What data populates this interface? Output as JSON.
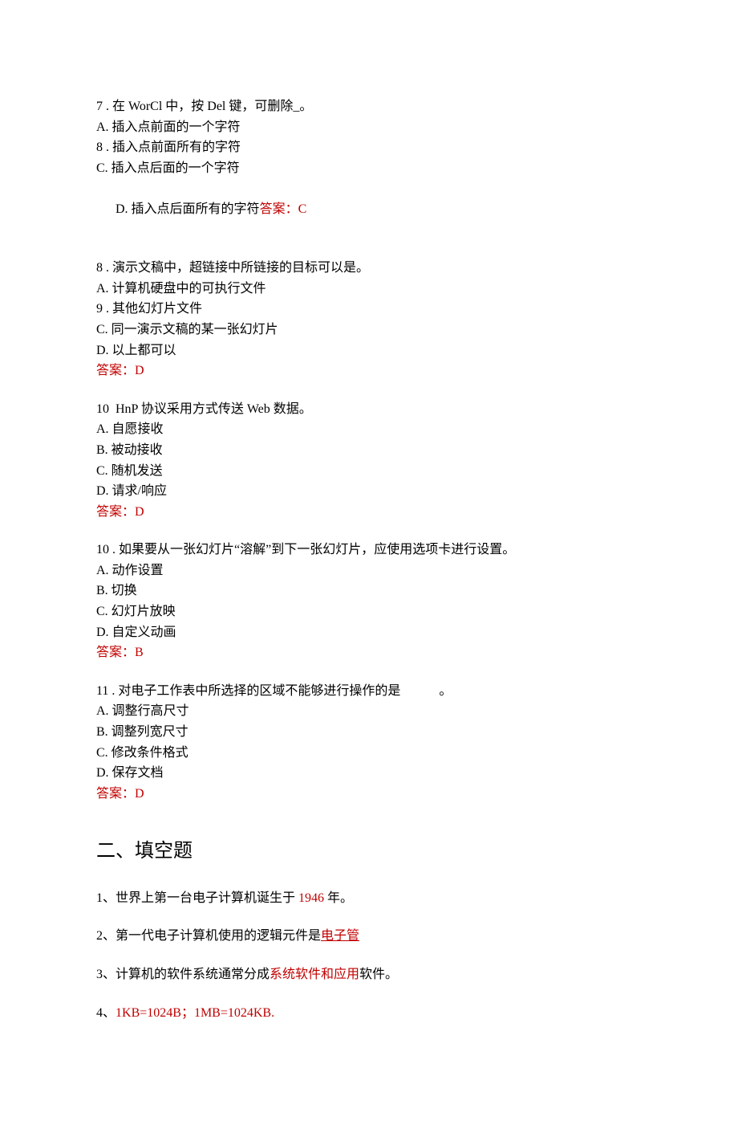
{
  "q7": {
    "stem": "7 . 在 WorCl 中，按 Del 键，可删除_。",
    "optA": "A. 插入点前面的一个字符",
    "optB": "8 . 插入点前面所有的字符",
    "optC": "C. 插入点后面的一个字符",
    "optD_prefix": "D. 插入点后面所有的字符",
    "optD_answer": "答案：C"
  },
  "q8": {
    "stem": "8 . 演示文稿中，超链接中所链接的目标可以是。",
    "optA": "A. 计算机硬盘中的可执行文件",
    "optB": "9 . 其他幻灯片文件",
    "optC": "C. 同一演示文稿的某一张幻灯片",
    "optD": "D. 以上都可以",
    "answer": "答案：D"
  },
  "q10a": {
    "stem": "10  HnP 协议采用方式传送 Web 数据。",
    "optA": "A. 自愿接收",
    "optB": "B. 被动接收",
    "optC": "C. 随机发送",
    "optD": "D. 请求/响应",
    "answer": "答案：D"
  },
  "q10b": {
    "stem": "10 . 如果要从一张幻灯片“溶解”到下一张幻灯片，应使用选项卡进行设置。",
    "optA": "A. 动作设置",
    "optB": "B. 切换",
    "optC": "C. 幻灯片放映",
    "optD": "D. 自定义动画",
    "answer": "答案：B"
  },
  "q11": {
    "stem": "11 . 对电子工作表中所选择的区域不能够进行操作的是　　　。",
    "optA": "A. 调整行高尺寸",
    "optB": "B. 调整列宽尺寸",
    "optC": "C. 修改条件格式",
    "optD": "D. 保存文档",
    "answer": "答案：D"
  },
  "section2_title": "二、填空题",
  "fill1": {
    "pre": "1、世界上第一台电子计算机诞生于 ",
    "ans": "1946 ",
    "post": "年。"
  },
  "fill2": {
    "pre": "2、第一代电子计算机使用的逻辑元件是",
    "ans": "电子管"
  },
  "fill3": {
    "pre": "3、计算机的软件系统通常分成",
    "ans": "系统软件和应用",
    "post": "软件。"
  },
  "fill4": {
    "pre": "4、",
    "ans": "1KB=1024B；1MB=1024KB."
  }
}
